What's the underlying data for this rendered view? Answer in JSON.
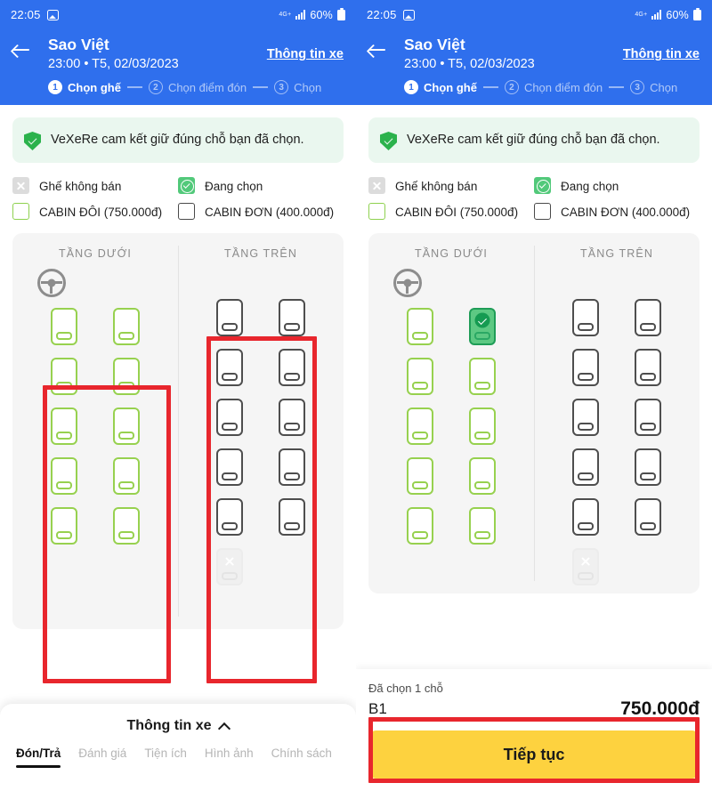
{
  "status_bar": {
    "time": "22:05",
    "photo_icon": "photo-icon",
    "network": "4G+",
    "signal_icon": "signal-bars-icon",
    "battery": "60%",
    "battery_icon": "battery-icon"
  },
  "header": {
    "back_icon": "back-arrow-icon",
    "operator": "Sao Việt",
    "departure": "23:00 • T5, 02/03/2023",
    "info_link": "Thông tin xe",
    "steps": [
      {
        "num": "1",
        "label": "Chọn ghế",
        "state": "active"
      },
      {
        "num": "2",
        "label": "Chọn điểm đón",
        "state": "idle"
      },
      {
        "num": "3",
        "label": "Chọn",
        "state": "idle"
      }
    ]
  },
  "notice": {
    "shield_icon": "shield-check-icon",
    "text": "VeXeRe cam kết giữ đúng chỗ bạn đã chọn."
  },
  "legend": [
    {
      "icon": "seat-unavailable-icon",
      "label": "Ghế không bán",
      "type": "disabled"
    },
    {
      "icon": "seat-selected-icon",
      "label": "Đang chọn",
      "type": "selected"
    },
    {
      "icon": "cabin-double-icon",
      "label": "CABIN ĐÔI (750.000đ)",
      "type": "double"
    },
    {
      "icon": "cabin-single-icon",
      "label": "CABIN ĐƠN (400.000đ)",
      "type": "single"
    }
  ],
  "seatmap": {
    "lower_deck_title": "TẦNG DƯỚI",
    "upper_deck_title": "TẦNG TRÊN",
    "wheel_icon": "steering-wheel-icon",
    "lower_rows_left": [
      [
        "green",
        "green"
      ],
      [
        "green",
        "green"
      ],
      [
        "green",
        "green"
      ],
      [
        "green",
        "green"
      ],
      [
        "green",
        "green"
      ]
    ],
    "lower_rows_right": [
      [
        "green",
        "selected"
      ],
      [
        "green",
        "green"
      ],
      [
        "green",
        "green"
      ],
      [
        "green",
        "green"
      ],
      [
        "green",
        "green"
      ]
    ],
    "upper_rows": [
      [
        "gray",
        "gray"
      ],
      [
        "gray",
        "gray"
      ],
      [
        "gray",
        "gray"
      ],
      [
        "gray",
        "gray"
      ],
      [
        "gray",
        "gray"
      ],
      [
        "off",
        "empty"
      ]
    ]
  },
  "sheet": {
    "title": "Thông tin xe",
    "caret_icon": "caret-up-icon",
    "tabs": [
      {
        "label": "Đón/Trả",
        "active": true
      },
      {
        "label": "Đánh giá",
        "active": false
      },
      {
        "label": "Tiện ích",
        "active": false
      },
      {
        "label": "Hình ảnh",
        "active": false
      },
      {
        "label": "Chính sách",
        "active": false
      }
    ]
  },
  "footer": {
    "selection_count": "Đã chọn 1 chỗ",
    "selected_seats": "B1",
    "price": "750.000đ",
    "cta_label": "Tiếp tục"
  },
  "colors": {
    "brand_blue": "#2f6fed",
    "seat_green": "#97d14f",
    "selected_green": "#5dc983",
    "cta_yellow": "#fdd23f",
    "annotation_red": "#e8262d"
  }
}
